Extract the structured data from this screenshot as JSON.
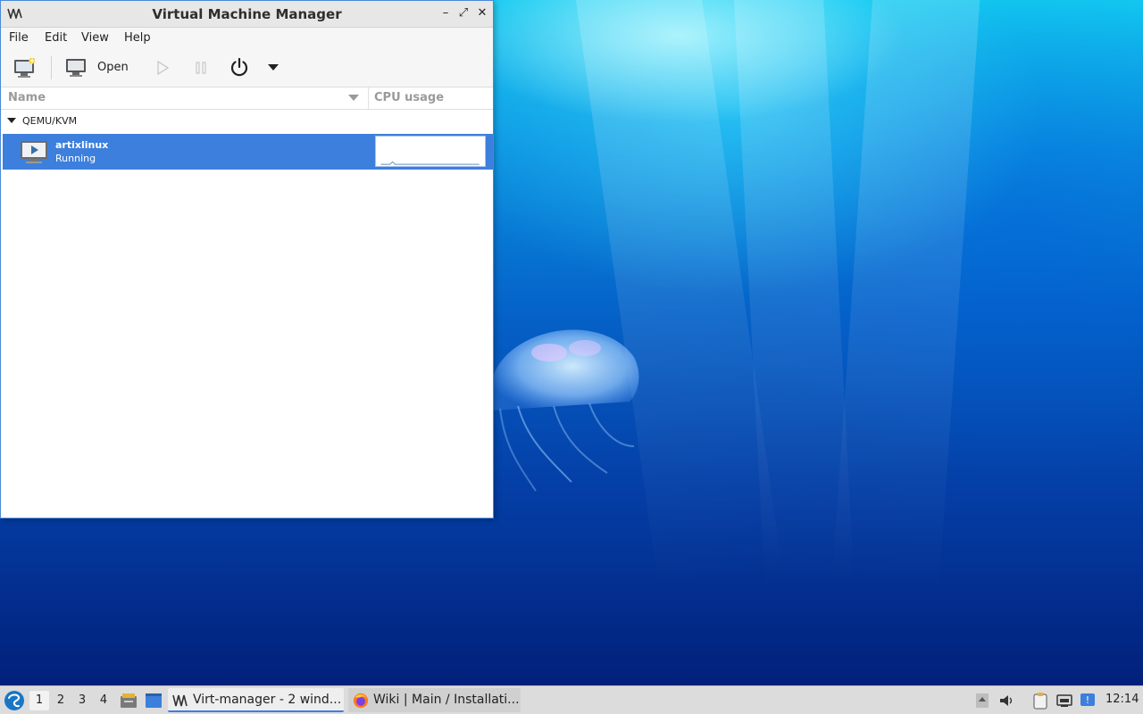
{
  "window": {
    "title": "Virtual Machine Manager",
    "controls": {
      "minimize": "–",
      "maximize": "⤢",
      "close": "✕"
    }
  },
  "menu": [
    "File",
    "Edit",
    "View",
    "Help"
  ],
  "toolbar": {
    "new_vm_icon": "new-vm-icon",
    "open_icon": "monitor-icon",
    "open_label": "Open",
    "run_icon": "play-icon",
    "pause_icon": "pause-icon",
    "shutdown_icon": "power-icon",
    "shutdown_menu_icon": "chevron-down-icon"
  },
  "columns": {
    "name": "Name",
    "cpu": "CPU usage"
  },
  "connections": [
    {
      "label": "QEMU/KVM",
      "vms": [
        {
          "name": "artixlinux",
          "status": "Running",
          "selected": true
        }
      ]
    }
  ],
  "taskbar": {
    "workspaces": [
      "1",
      "2",
      "3",
      "4"
    ],
    "active_workspace": "1",
    "tasks": [
      {
        "label": "Virt-manager - 2 wind...",
        "icon": "virt-manager-icon",
        "active": true
      },
      {
        "label": "Wiki | Main / Installati...",
        "icon": "firefox-icon",
        "active": false
      }
    ],
    "clock": "12:14"
  },
  "colors": {
    "selection": "#3d7fdc",
    "window_border": "#4a8ad6",
    "taskbar": "#dcdcdc"
  }
}
